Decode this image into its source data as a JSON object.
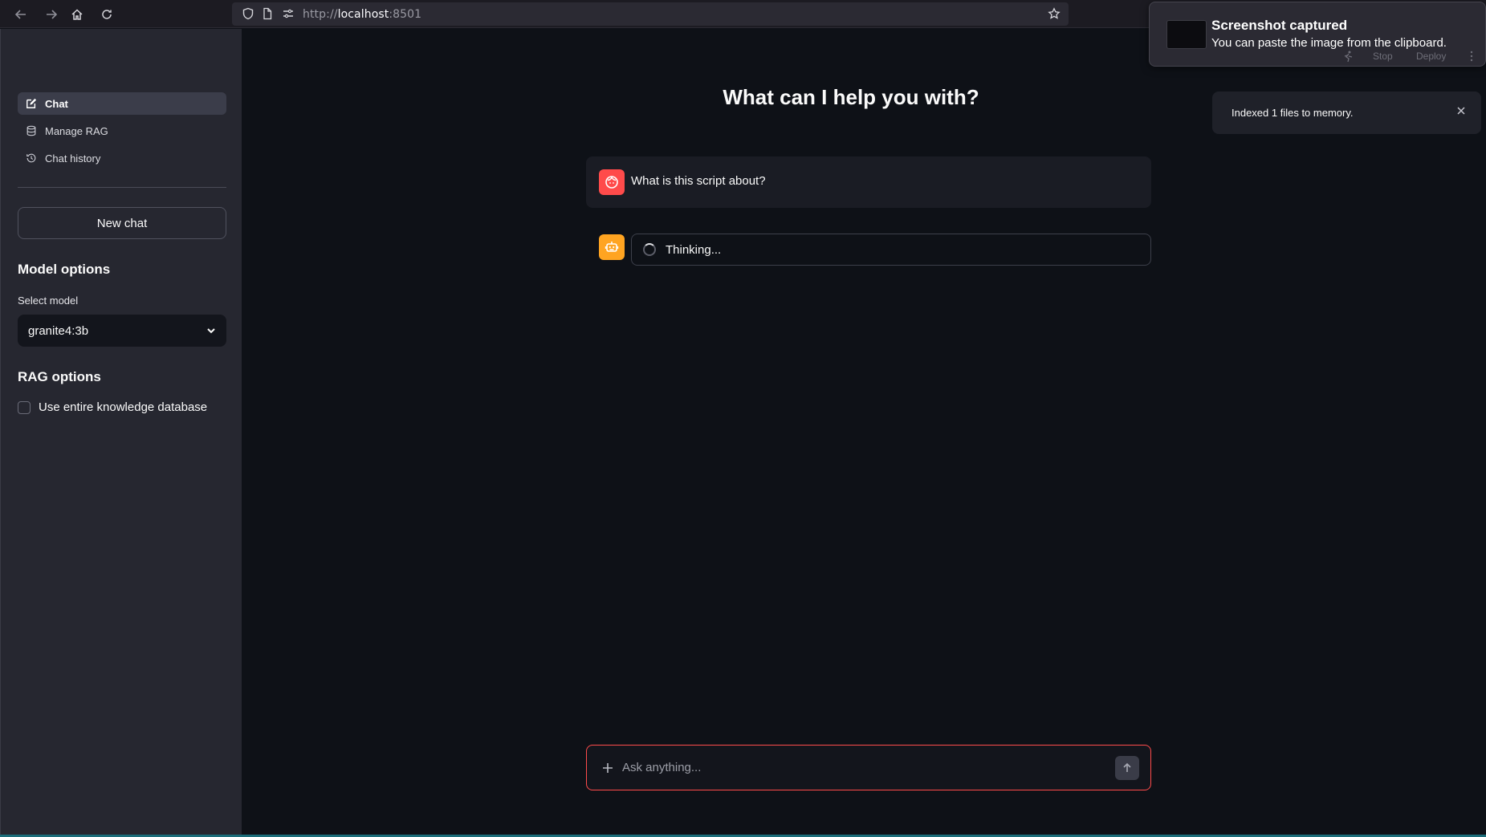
{
  "browser": {
    "url_prefix": "http://",
    "url_host": "localhost",
    "url_port": ":8501"
  },
  "sidebar": {
    "nav": [
      {
        "label": "Chat",
        "icon": "edit-icon",
        "active": true
      },
      {
        "label": "Manage RAG",
        "icon": "database-icon",
        "active": false
      },
      {
        "label": "Chat history",
        "icon": "history-icon",
        "active": false
      }
    ],
    "new_chat_label": "New chat",
    "model_options_title": "Model options",
    "select_model_label": "Select model",
    "selected_model": "granite4:3b",
    "rag_options_title": "RAG options",
    "use_entire_kb_label": "Use entire knowledge database",
    "use_entire_kb_checked": false
  },
  "main": {
    "title": "What can I help you with?",
    "messages": [
      {
        "role": "user",
        "text": "What is this script about?"
      },
      {
        "role": "assistant",
        "status": "Thinking..."
      }
    ],
    "input_placeholder": "Ask anything..."
  },
  "screenshot_notice": {
    "title": "Screenshot captured",
    "subtitle": "You can paste the image from the clipboard.",
    "ghost_stop": "Stop",
    "ghost_deploy": "Deploy"
  },
  "toast": {
    "text": "Indexed 1 files to memory."
  },
  "colors": {
    "primary": "#ff4b4b",
    "bot_avatar": "#ffa421",
    "sidebar_bg": "#262730",
    "main_bg": "#0e1117"
  }
}
